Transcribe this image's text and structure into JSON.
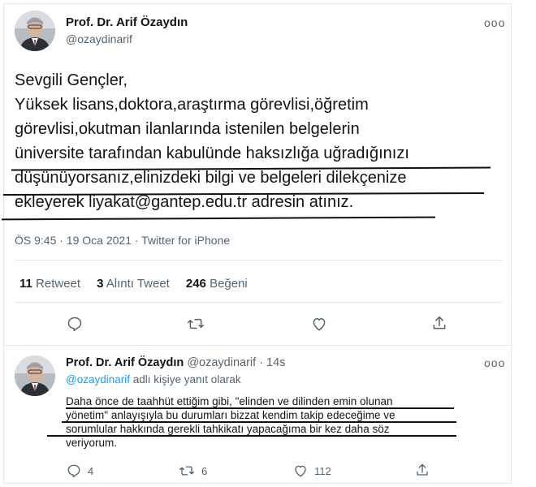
{
  "main_tweet": {
    "author_name": "Prof. Dr. Arif Özaydın",
    "handle": "@ozaydinarif",
    "more": "ooo",
    "lines": [
      "Sevgili Gençler,",
      "Yüksek lisans,doktora,araştırma görevlisi,öğretim",
      "görevlisi,okutman ilanlarında istenilen belgelerin",
      "üniversite tarafından kabulünde haksızlığa uğradığınızı",
      "düşünüyorsanız,elinizdeki bilgi ve belgeleri dilekçenize",
      "ekleyerek liyakat@gantep.edu.tr adresin atınız."
    ],
    "timestamp": "ÖS 9:45 · 19 Oca 2021 · Twitter for iPhone",
    "stats": {
      "retweets_count": "11",
      "retweets_label": "Retweet",
      "quotes_count": "3",
      "quotes_label": "Alıntı Tweet",
      "likes_count": "246",
      "likes_label": "Beğeni"
    }
  },
  "reply_tweet": {
    "author_name": "Prof. Dr. Arif Özaydın",
    "handle_time": "@ozaydinarif · 14s",
    "more": "ooo",
    "reply_to_handle": "@ozaydinarif",
    "reply_to_suffix": "adlı kişiye yanıt olarak",
    "lines": [
      "Daha önce de taahhüt ettiğim gibi, \"elinden ve dilinden emin olunan",
      "yönetim\" anlayışıyla bu durumları bizzat kendim takip edeceğime ve",
      "sorumlular hakkında gerekli tahkikatı yapacağıma bir kez daha söz",
      "veriyorum."
    ],
    "actions": {
      "reply_count": "4",
      "retweet_count": "6",
      "like_count": "112"
    }
  },
  "colors": {
    "link": "#1d9bf0",
    "secondary": "#536471",
    "text": "#0f1419"
  }
}
